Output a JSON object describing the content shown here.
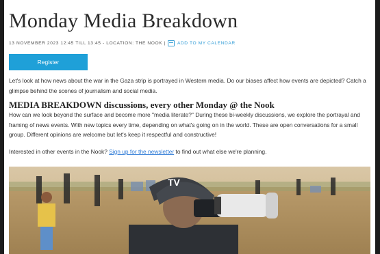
{
  "event": {
    "title": "Monday Media Breakdown",
    "meta_text": "13 NOVEMBER 2023 12:45 TILL 13:45 - LOCATION: THE NOOK |",
    "calendar_link": "ADD TO MY CALENDAR",
    "register_label": "Register",
    "intro": "Let's look at how news about the war in the Gaza strip is portrayed in Western media. Do our biases affect how events are depicted? Catch a glimpse behind the scenes of journalism and social media.",
    "section_heading": "MEDIA BREAKDOWN discussions, every other Monday @ the Nook",
    "section_body": "How can we look beyond the surface and become more \"media literate?\" During these bi-weekly discussions, we explore the portrayal and framing of news events. With new topics every time, depending on what's going on in the world. These are open conversations for a small group. Different opinions are welcome but let's keep it respectful and constructive!",
    "newsletter_prefix": "Interested in other events in the Nook? ",
    "newsletter_link": "Sign up for the newsletter",
    "newsletter_suffix": " to find out what else we're planning.",
    "helmet_text": "TV"
  },
  "colors": {
    "accent": "#1fa0d8",
    "link": "#2f7bd6"
  },
  "icons": [
    "calendar-icon"
  ]
}
